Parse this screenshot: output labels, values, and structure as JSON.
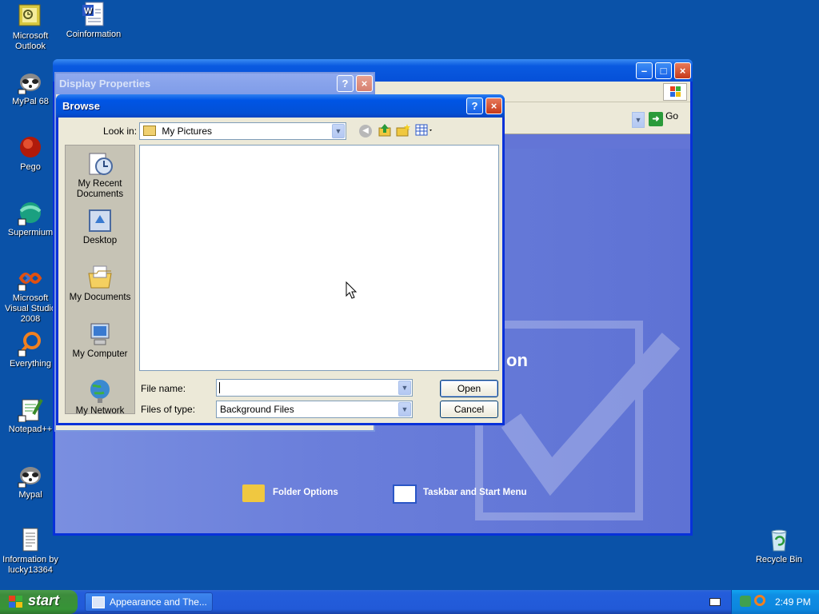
{
  "desktop": {
    "icons": [
      {
        "label": "Microsoft Outlook"
      },
      {
        "label": "Coinformation"
      },
      {
        "label": "MyPal 68"
      },
      {
        "label": "Pego"
      },
      {
        "label": "Supermium"
      },
      {
        "label": "Microsoft Visual Studio 2008"
      },
      {
        "label": "Everything"
      },
      {
        "label": "Notepad++"
      },
      {
        "label": "Mypal"
      },
      {
        "label": "Information by lucky13364"
      },
      {
        "label": "Recycle Bin"
      }
    ]
  },
  "background_window": {
    "go_label": "Go",
    "partial_heading": "on",
    "folder_options": "Folder Options",
    "taskbar_start_menu": "Taskbar and Start Menu"
  },
  "display_properties": {
    "title": "Display Properties"
  },
  "browse": {
    "title": "Browse",
    "look_in_label": "Look in:",
    "look_in_value": "My Pictures",
    "places": [
      {
        "label": "My Recent Documents"
      },
      {
        "label": "Desktop"
      },
      {
        "label": "My Documents"
      },
      {
        "label": "My Computer"
      },
      {
        "label": "My Network"
      }
    ],
    "file_name_label": "File name:",
    "file_name_value": "",
    "files_of_type_label": "Files of type:",
    "files_of_type_value": "Background Files",
    "open_button": "Open",
    "cancel_button": "Cancel"
  },
  "taskbar": {
    "start_label": "start",
    "task_item": "Appearance and The...",
    "clock": "2:49 PM"
  }
}
